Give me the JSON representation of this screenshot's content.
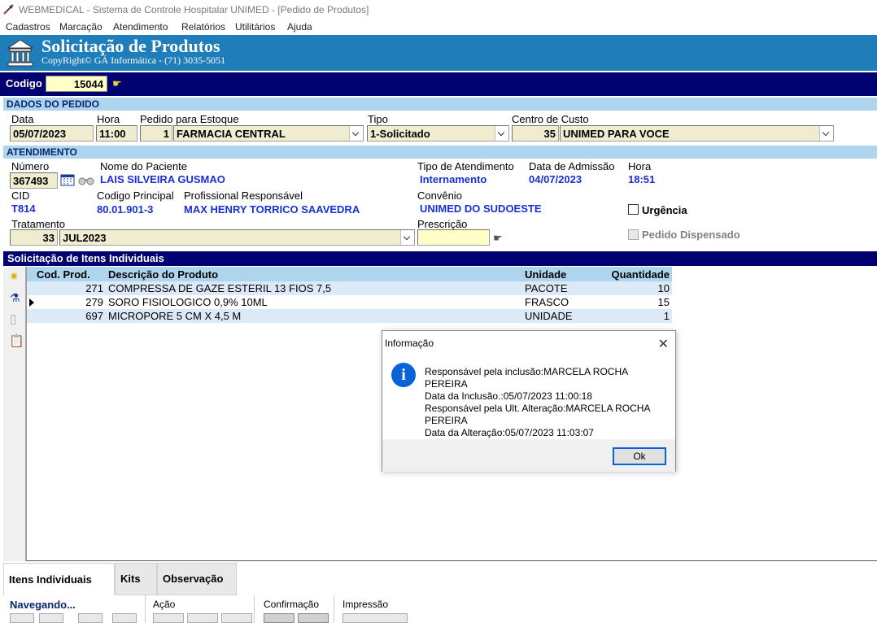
{
  "window": {
    "title": "WEBMEDICAL - Sistema de Controle Hospitalar UNIMED - [Pedido de Produtos]"
  },
  "menu": [
    "Cadastros",
    "Marcação",
    "Atendimento",
    "Relatórios",
    "Utilitários",
    "Ajuda"
  ],
  "banner": {
    "title": "Solicitação de Produtos",
    "subtitle": "CopyRight© GÁ Informática - (71) 3035-5051"
  },
  "codigo": {
    "label": "Codigo",
    "value": "15044"
  },
  "pedido": {
    "section": "DADOS DO PEDIDO",
    "data_label": "Data",
    "data": "05/07/2023",
    "hora_label": "Hora",
    "hora": "11:00",
    "estoque_label": "Pedido para Estoque",
    "estoque_code": "1",
    "estoque": "FARMACIA CENTRAL",
    "tipo_label": "Tipo",
    "tipo": "1-Solicitado",
    "custo_label": "Centro de Custo",
    "custo_code": "35",
    "custo": "UNIMED PARA VOCE"
  },
  "atendimento": {
    "section": "ATENDIMENTO",
    "numero_label": "Número",
    "numero": "367493",
    "paciente_label": "Nome do Paciente",
    "paciente": "LAIS SILVEIRA GUSMAO",
    "tipo_label": "Tipo de Atendimento",
    "tipo": "Internamento",
    "admissao_label": "Data de Admissão",
    "admissao": "04/07/2023",
    "hora_label": "Hora",
    "hora": "18:51",
    "cid_label": "CID",
    "cid": "T814",
    "codigo_label": "Codigo Principal",
    "codigo": "80.01.901-3",
    "profissional_label": "Profissional Responsável",
    "profissional": "MAX HENRY TORRICO SAAVEDRA",
    "convenio_label": "Convênio",
    "convenio": "UNIMED DO SUDOESTE",
    "urgencia_label": "Urgência",
    "tratamento_label": "Tratamento",
    "tratamento_code": "33",
    "tratamento": "JUL2023",
    "prescricao_label": "Prescrição",
    "dispensado_label": "Pedido Dispensado"
  },
  "items": {
    "title": "Solicitação de Itens Individuais",
    "columns": [
      "Cod. Prod.",
      "Descrição do Produto",
      "Unidade",
      "Quantidade"
    ],
    "rows": [
      [
        "271",
        "COMPRESSA DE GAZE ESTERIL 13 FIOS 7,5",
        "PACOTE",
        "10"
      ],
      [
        "279",
        "SORO FISIOLOGICO 0,9% 10ML",
        "FRASCO",
        "15"
      ],
      [
        "697",
        "MICROPORE  5 CM X 4,5 M",
        "UNIDADE",
        "1"
      ]
    ]
  },
  "tabs": [
    "Itens Individuais",
    "Kits",
    "Observação"
  ],
  "bottom": {
    "nav": "Navegando...",
    "acao": "Ação",
    "confirmacao": "Confirmação",
    "impressao": "Impressão"
  },
  "dialog": {
    "title": "Informação",
    "lines": [
      "Responsável pela inclusão:MARCELA ROCHA PEREIRA",
      "Data da Inclusão.:05/07/2023 11:00:18",
      "Responsável pela Ult. Alteração:MARCELA ROCHA PEREIRA",
      "Data da Alteração:05/07/2023 11:03:07"
    ],
    "ok": "Ok"
  }
}
